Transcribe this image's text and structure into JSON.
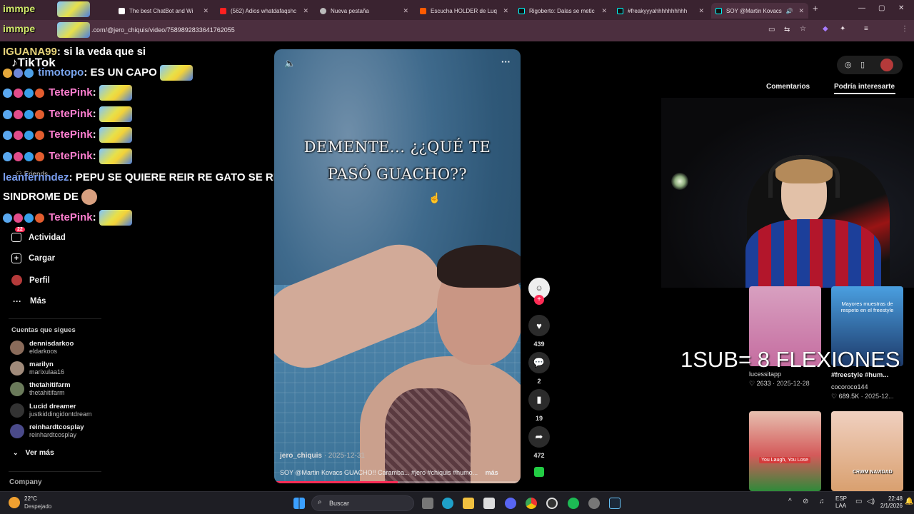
{
  "browser": {
    "tabs": [
      {
        "title": "The best ChatBot and Wi",
        "fav": "#ffffff"
      },
      {
        "title": "(562) Adios whatdafaqshc",
        "fav": "#ff2020"
      },
      {
        "title": "Nueva pestaña",
        "fav": "#cccccc"
      },
      {
        "title": "Escucha HOLDER de Luq",
        "fav": "#ff5a00"
      },
      {
        "title": "Rigoberto: Dalas se metic",
        "fav": "#111111"
      },
      {
        "title": "#freakyyyahhhhhhhhhh",
        "fav": "#111111"
      },
      {
        "title": "SOY @Martin Kovacs",
        "fav": "#111111"
      }
    ],
    "url": ".com/@jero_chiquis/video/7589892833641762055",
    "new_tab": "+"
  },
  "tiktok": {
    "logo": "TikTok",
    "nav": [
      {
        "label": "Actividad",
        "badge": "22",
        "icon": "inbox-icon"
      },
      {
        "label": "Cargar",
        "icon": "upload-icon"
      },
      {
        "label": "Perfil",
        "icon": "profile-icon"
      },
      {
        "label": "Más",
        "icon": "more-icon"
      }
    ],
    "friends_label": "Friends",
    "following_title": "Cuentas que sigues",
    "following": [
      {
        "name": "dennisdarkoo",
        "handle": "eldarkoos",
        "color": "#8a6b5a"
      },
      {
        "name": "marilyn",
        "handle": "marixulaa16",
        "color": "#a08a7a"
      },
      {
        "name": "thetahitifarm",
        "handle": "thetahitifarm",
        "color": "#6a7a5a"
      },
      {
        "name": "Lucid dreamer",
        "handle": "justkiddingidontdream",
        "color": "#333333"
      },
      {
        "name": "reinhardtcosplay",
        "handle": "reinhardtcosplay",
        "color": "#4a4a8a"
      }
    ],
    "see_more": "Ver más",
    "company": "Company",
    "right_tabs": [
      "Comentarios",
      "Podría interesarte"
    ]
  },
  "chat": [
    {
      "user": "IGUANA99",
      "color": "#e6d37a",
      "msg": ": si la veda que si"
    },
    {
      "user": "timotopo",
      "color": "#7aa6f0",
      "msg": ": ES UN CAPO"
    },
    {
      "user": "TetePink",
      "color": "#ff7fd0",
      "msg": ":"
    },
    {
      "user": "TetePink",
      "color": "#ff7fd0",
      "msg": ":"
    },
    {
      "user": "TetePink",
      "color": "#ff7fd0",
      "msg": ":"
    },
    {
      "user": "TetePink",
      "color": "#ff7fd0",
      "msg": ":"
    },
    {
      "user": "leanfernndez",
      "color": "#7a9ef0",
      "msg": ": PEPU SE QUIERE REIR RE GATO SE RIE DE UN"
    },
    {
      "user": "",
      "color": "#ffffff",
      "msg": "SINDROME DE"
    },
    {
      "user": "TetePink",
      "color": "#ff7fd0",
      "msg": ":"
    }
  ],
  "streamer_label": "immpe",
  "video": {
    "overlay_line1": "DEMENTE... ¿¿QUÉ TE",
    "overlay_line2": "PASÓ GUACHO??",
    "author": "jero_chiquis",
    "date": "· 2025-12-31",
    "caption": "SOY @Martin Kovacs GUACHO!! Caramba... #jero #chiquis #humo...",
    "more": "más",
    "progress": 0.5
  },
  "actions": {
    "likes": "439",
    "comments": "2",
    "saves": "19",
    "shares": "472"
  },
  "suggested": [
    {
      "author": "lucessitapp",
      "likes": "2633",
      "date": "· 2025-12-28",
      "title": "",
      "color": "#c56da0"
    },
    {
      "author": "cocoroco144",
      "likes": "689.5K",
      "date": "· 2025-12...",
      "title": "#freestyle #hum...",
      "color": "#3a78c0",
      "overlay": "Mayores muestras de respeto en el freestyle"
    },
    {
      "author": "",
      "likes": "",
      "date": "",
      "title": "",
      "color": "#d45a5a",
      "overlay": "You Laugh, You Lose"
    },
    {
      "author": "",
      "likes": "",
      "date": "",
      "title": "",
      "color": "#d9a06f",
      "overlay": "CRWM NAVIDAD"
    }
  ],
  "stream_overlay": "1SUB= 8 FLEXIONES",
  "taskbar": {
    "weather_temp": "22°C",
    "weather_desc": "Despejado",
    "search": "Buscar",
    "lang1": "ESP",
    "lang2": "LAA",
    "time": "22:48",
    "date": "2/1/2026"
  }
}
